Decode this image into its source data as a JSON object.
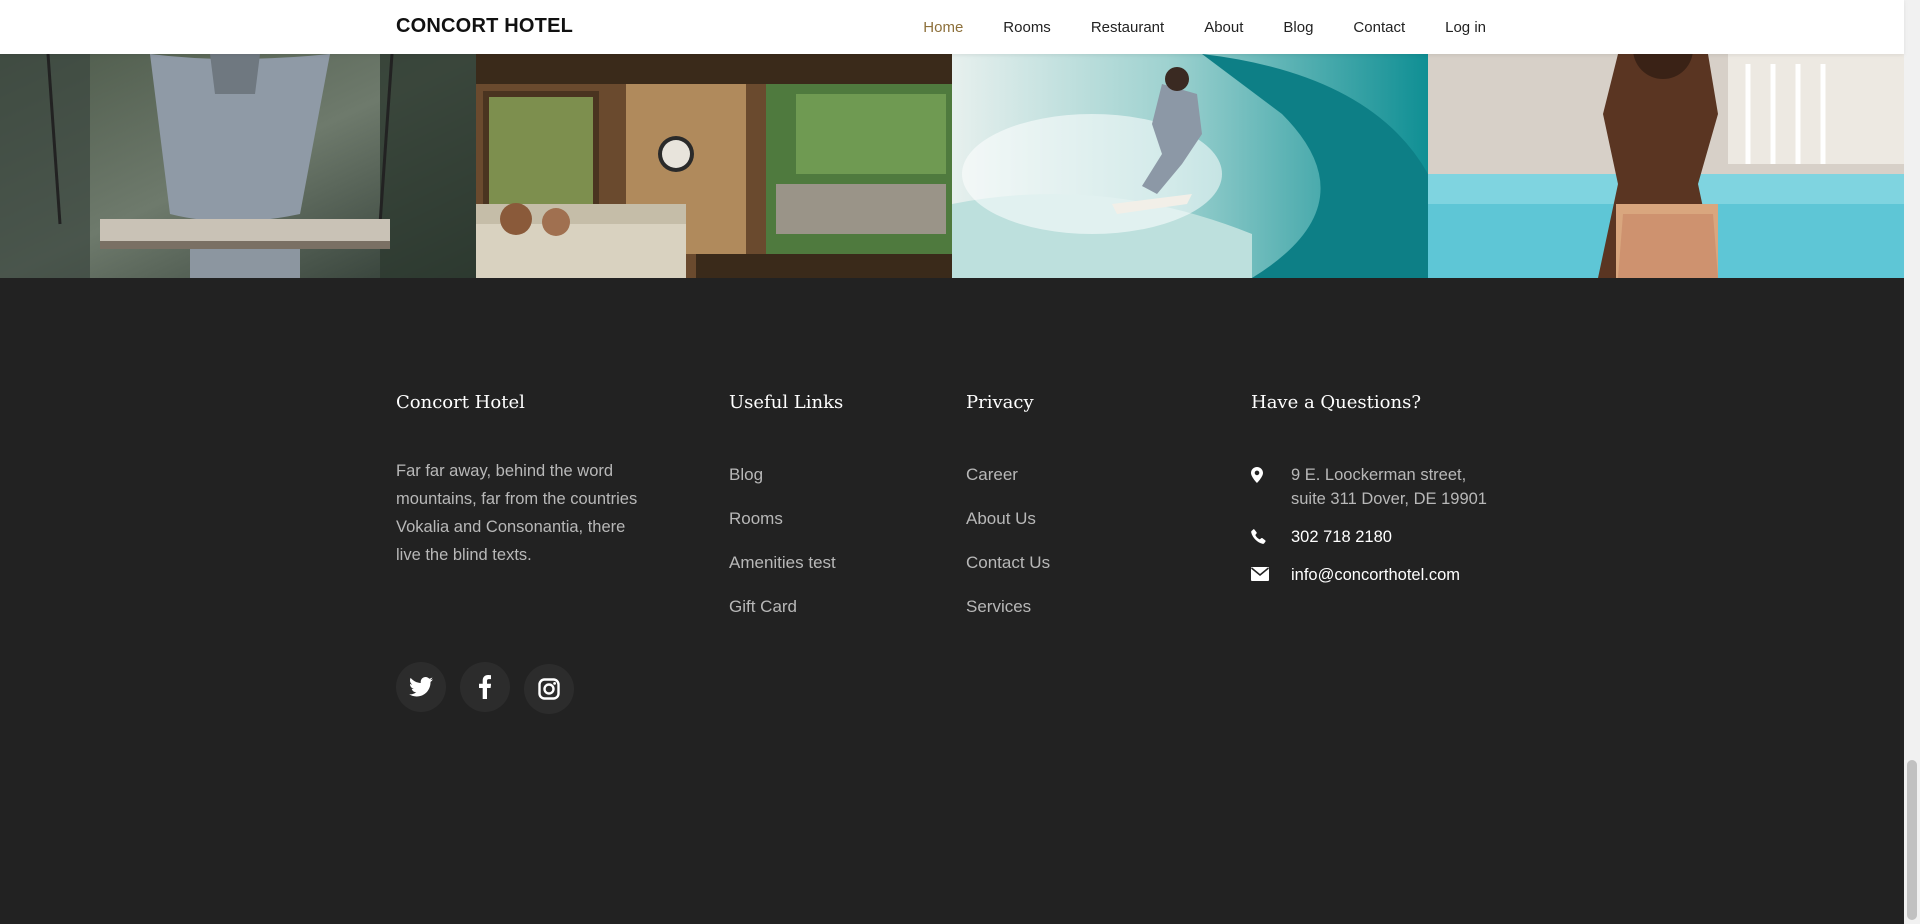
{
  "brand": "CONCORT HOTEL",
  "nav": {
    "items": [
      {
        "label": "Home",
        "active": true
      },
      {
        "label": "Rooms"
      },
      {
        "label": "Restaurant"
      },
      {
        "label": "About"
      },
      {
        "label": "Blog"
      },
      {
        "label": "Contact"
      },
      {
        "label": "Log in"
      }
    ]
  },
  "gallery": {
    "tiles": [
      {
        "icon": "photo-woman-on-swing"
      },
      {
        "icon": "photo-living-room"
      },
      {
        "icon": "photo-surfer-wave"
      },
      {
        "icon": "photo-woman-by-pool"
      }
    ]
  },
  "footer": {
    "about": {
      "title": "Concort Hotel",
      "text": "Far far away, behind the word mountains, far from the countries Vokalia and Consonantia, there live the blind texts."
    },
    "useful_links": {
      "title": "Useful Links",
      "items": [
        "Blog",
        "Rooms",
        "Amenities test",
        "Gift Card"
      ]
    },
    "privacy": {
      "title": "Privacy",
      "items": [
        "Career",
        "About Us",
        "Contact Us",
        "Services"
      ]
    },
    "questions": {
      "title": "Have a Questions?",
      "address": "9 E. Loockerman street, suite 311 Dover, DE 19901",
      "phone": "302 718 2180",
      "email": "info@concorthotel.com"
    },
    "socials": [
      {
        "icon": "twitter-icon"
      },
      {
        "icon": "facebook-icon"
      },
      {
        "icon": "instagram-icon"
      }
    ]
  },
  "colors": {
    "footer_bg": "#222222",
    "nav_active": "#8d703b",
    "muted_text": "#b8b8b8"
  }
}
